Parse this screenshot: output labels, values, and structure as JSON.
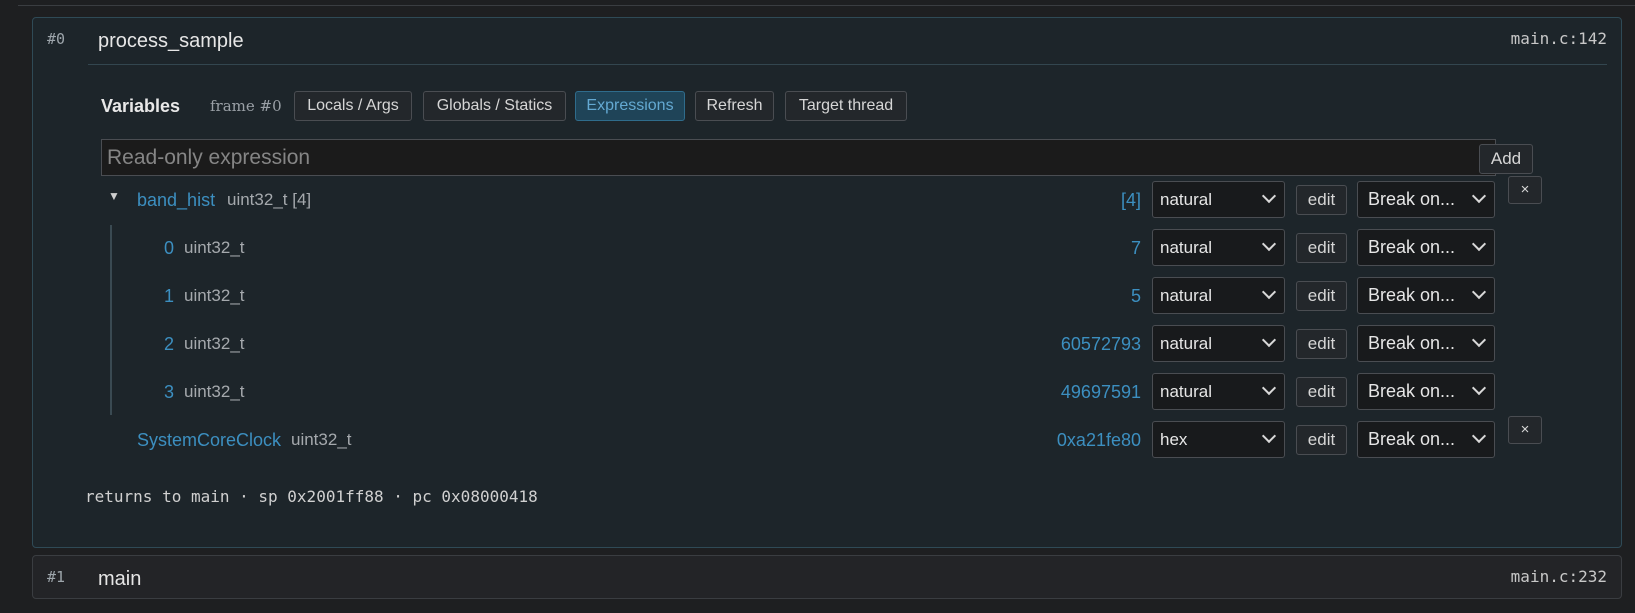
{
  "frames": [
    {
      "num": "#0",
      "name": "process_sample",
      "loc": "main.c:142",
      "variables": {
        "title": "Variables",
        "frame_label": "frame #0",
        "tabs": [
          {
            "label": "Locals / Args",
            "selected": false
          },
          {
            "label": "Globals / Statics",
            "selected": false
          },
          {
            "label": "Expressions",
            "selected": true
          },
          {
            "label": "Refresh",
            "selected": false
          },
          {
            "label": "Target thread",
            "selected": false
          }
        ],
        "expression_placeholder": "Read-only expression",
        "add_label": "Add",
        "rows": [
          {
            "name": "band_hist",
            "type": "uint32_t [4]",
            "value": "[4]",
            "format": "natural",
            "edit": "edit",
            "break": "Break on...",
            "remove": "×",
            "expanded": true
          },
          {
            "name": "0",
            "type": "uint32_t",
            "value": "7",
            "format": "natural",
            "edit": "edit",
            "break": "Break on..."
          },
          {
            "name": "1",
            "type": "uint32_t",
            "value": "5",
            "format": "natural",
            "edit": "edit",
            "break": "Break on..."
          },
          {
            "name": "2",
            "type": "uint32_t",
            "value": "60572793",
            "format": "natural",
            "edit": "edit",
            "break": "Break on..."
          },
          {
            "name": "3",
            "type": "uint32_t",
            "value": "49697591",
            "format": "natural",
            "edit": "edit",
            "break": "Break on..."
          },
          {
            "name": "SystemCoreClock",
            "type": "uint32_t",
            "value": "0xa21fe80",
            "format": "hex",
            "edit": "edit",
            "break": "Break on...",
            "remove": "×"
          }
        ]
      },
      "returns": "returns to main · sp 0x2001ff88 · pc 0x08000418"
    },
    {
      "num": "#1",
      "name": "main",
      "loc": "main.c:232"
    }
  ],
  "colors": {
    "accent": "#3c8fc0",
    "selected_tab_bg": "#1f4458",
    "frame_border": "#2f4a56"
  }
}
